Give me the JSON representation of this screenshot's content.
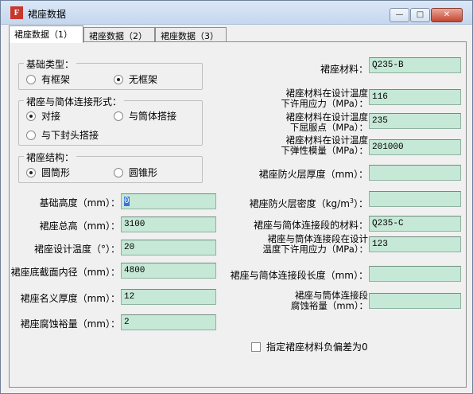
{
  "window": {
    "title": "裙座数据",
    "app_icon": "app-icon",
    "min": "—",
    "max": "□",
    "close": "✕"
  },
  "tabs": [
    "裙座数据（1）",
    "裙座数据（2）",
    "裙座数据（3）"
  ],
  "foundation_type": {
    "label": "基础类型：",
    "options": [
      "有框架",
      "无框架"
    ],
    "selected": 1
  },
  "connection": {
    "label": "裙座与简体连接形式：",
    "options": [
      "对接",
      "与筒体搭接",
      "与下封头搭接"
    ],
    "selected": 0
  },
  "structure": {
    "label": "裙座结构：",
    "options": [
      "圆筒形",
      "圆锥形"
    ],
    "selected": 0
  },
  "left_fields": [
    {
      "label": "基础高度（mm）：",
      "value": "0"
    },
    {
      "label": "裙座总高（mm）：",
      "value": "3100"
    },
    {
      "label": "裙座设计温度（°）：",
      "value": "20"
    },
    {
      "label": "裙座底截面内径（mm）：",
      "value": "4800"
    },
    {
      "label": "裙座名义厚度（mm）：",
      "value": "12"
    },
    {
      "label": "裙座腐蚀裕量（mm）：",
      "value": "2"
    }
  ],
  "right_fields": {
    "material": {
      "label": "裙座材料：",
      "value": "Q235-B"
    },
    "allowable_stress": {
      "line1": "裙座材料在设计温度",
      "line2": "下许用应力（MPa）：",
      "value": "116"
    },
    "yield_point": {
      "line1": "裙座材料在设计温度",
      "line2": "下屈服点（MPa）：",
      "value": "235"
    },
    "elastic_modulus": {
      "line1": "裙座材料在设计温度",
      "line2": "下弹性模量（MPa）：",
      "value": "201000"
    },
    "fire_thickness": {
      "label": "裙座防火层厚度（mm）：",
      "value": ""
    },
    "fire_density": {
      "label_pre": "裙座防火层密度（kg/m",
      "label_sup": "3",
      "label_post": "）：",
      "value": ""
    },
    "conn_material": {
      "label": "裙座与简体连接段的材料：",
      "value": "Q235-C"
    },
    "conn_stress": {
      "line1": "裙座与筒体连接段在设计",
      "line2": "温度下许用应力（MPa）：",
      "value": "123"
    },
    "conn_length": {
      "label": "裙座与简体连接段长度（mm）：",
      "value": ""
    },
    "conn_corrosion": {
      "line1": "裙座与筒体连接段",
      "line2": "腐蚀裕量（mm）：",
      "value": ""
    }
  },
  "checkbox": {
    "label": "指定裙座材料负偏差为0",
    "checked": false
  }
}
